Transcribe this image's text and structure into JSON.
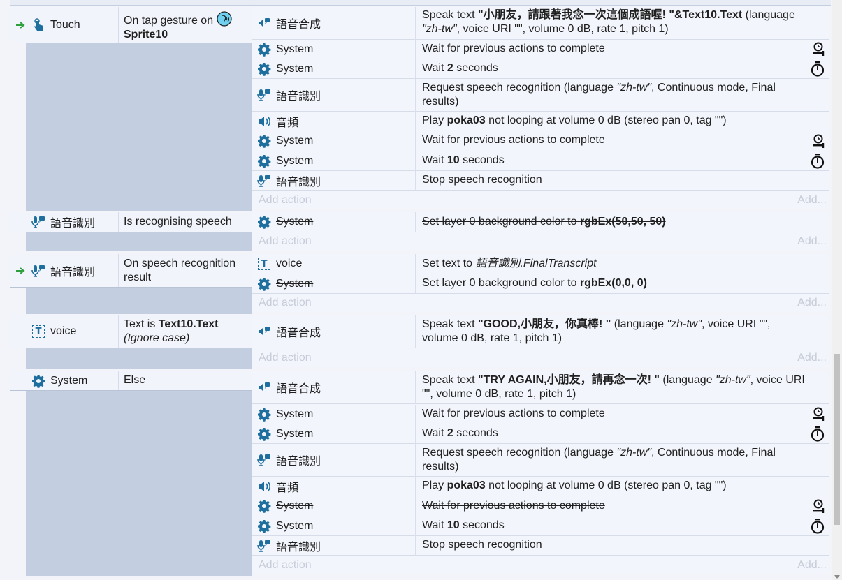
{
  "colors": {
    "accent_blue": "#1f6f9e",
    "trigger_green": "#2e9e3c",
    "event_bg": "#c3cee0",
    "row_bg": "#f2f5fb"
  },
  "add_action": "Add action",
  "add": "Add...",
  "events": [
    {
      "condition": {
        "object": "Touch",
        "text": "On tap gesture on",
        "target": "Sprite10",
        "icon": "touch-icon",
        "trigger": true
      },
      "actions": [
        {
          "object": "語音合成",
          "icon": "speech-synthesis-icon",
          "text_pre": "Speak text ",
          "text_b": "\"小朋友，請跟著我念一次這個成語喔! \"&Text10.Text",
          "text_mid": " (language ",
          "text_i": "\"zh-tw\"",
          "text_post": ", voice URI \"\", volume 0 dB, rate 1, pitch 1)"
        },
        {
          "object": "System",
          "icon": "gear-icon",
          "text": "Wait for previous actions to complete",
          "right_icon": "wait-signal-icon"
        },
        {
          "object": "System",
          "icon": "gear-icon",
          "text_pre": "Wait ",
          "text_b": "2",
          "text_post": " seconds",
          "right_icon": "stopwatch-icon"
        },
        {
          "object": "語音識別",
          "icon": "speech-recognition-icon",
          "text_pre": "Request speech recognition (language ",
          "text_i": "\"zh-tw\"",
          "text_post": ", Continuous mode, Final results)"
        },
        {
          "object": "音頻",
          "icon": "speaker-icon",
          "text_pre": "Play ",
          "text_b": "poka03",
          "text_post": " not looping at volume 0 dB (stereo pan 0, tag \"\")"
        },
        {
          "object": "System",
          "icon": "gear-icon",
          "text": "Wait for previous actions to complete",
          "right_icon": "wait-signal-icon"
        },
        {
          "object": "System",
          "icon": "gear-icon",
          "text_pre": "Wait ",
          "text_b": "10",
          "text_post": " seconds",
          "right_icon": "stopwatch-icon"
        },
        {
          "object": "語音識別",
          "icon": "speech-recognition-icon",
          "text": "Stop speech recognition"
        }
      ]
    },
    {
      "condition": {
        "object": "語音識別",
        "text": "Is recognising speech",
        "icon": "speech-recognition-icon",
        "trigger": false
      },
      "actions": [
        {
          "object": "System",
          "icon": "gear-icon",
          "text_pre": "Set layer 0 background color to ",
          "text_b": "rgbEx(50,50, 50)",
          "disabled": true
        }
      ]
    },
    {
      "condition": {
        "object": "語音識別",
        "text": "On speech recognition result",
        "icon": "speech-recognition-icon",
        "trigger": true
      },
      "actions": [
        {
          "object": "voice",
          "icon": "text-object-icon",
          "text_pre": "Set text to ",
          "text_i": "語音識別.FinalTranscript"
        },
        {
          "object": "System",
          "icon": "gear-icon",
          "text_pre": "Set layer 0 background color to ",
          "text_b": "rgbEx(0,0, 0)",
          "disabled": true
        }
      ]
    },
    {
      "condition": {
        "object": "voice",
        "text": "Text is",
        "target": "Text10.Text",
        "sub": "(Ignore case)",
        "icon": "text-object-icon",
        "trigger": false
      },
      "actions": [
        {
          "object": "語音合成",
          "icon": "speech-synthesis-icon",
          "text_pre": "Speak text ",
          "text_b": "\"GOOD,小朋友，你真棒! \"",
          "text_mid": " (language ",
          "text_i": "\"zh-tw\"",
          "text_post": ", voice URI \"\", volume 0 dB, rate 1, pitch 1)"
        }
      ]
    },
    {
      "condition": {
        "object": "System",
        "text": "Else",
        "icon": "gear-icon",
        "trigger": false
      },
      "actions": [
        {
          "object": "語音合成",
          "icon": "speech-synthesis-icon",
          "text_pre": "Speak text ",
          "text_b": "\"TRY AGAIN,小朋友，請再念一次! \"",
          "text_mid": " (language ",
          "text_i": "\"zh-tw\"",
          "text_post": ", voice URI \"\", volume 0 dB, rate 1, pitch 1)"
        },
        {
          "object": "System",
          "icon": "gear-icon",
          "text": "Wait for previous actions to complete",
          "right_icon": "wait-signal-icon"
        },
        {
          "object": "System",
          "icon": "gear-icon",
          "text_pre": "Wait ",
          "text_b": "2",
          "text_post": " seconds",
          "right_icon": "stopwatch-icon"
        },
        {
          "object": "語音識別",
          "icon": "speech-recognition-icon",
          "text_pre": "Request speech recognition (language ",
          "text_i": "\"zh-tw\"",
          "text_post": ", Continuous mode, Final results)"
        },
        {
          "object": "音頻",
          "icon": "speaker-icon",
          "text_pre": "Play ",
          "text_b": "poka03",
          "text_post": " not looping at volume 0 dB (stereo pan 0, tag \"\")"
        },
        {
          "object": "System",
          "icon": "gear-icon",
          "text": "Wait for previous actions to complete",
          "right_icon": "wait-signal-icon",
          "disabled": true
        },
        {
          "object": "System",
          "icon": "gear-icon",
          "text_pre": "Wait ",
          "text_b": "10",
          "text_post": " seconds",
          "right_icon": "stopwatch-icon"
        },
        {
          "object": "語音識別",
          "icon": "speech-recognition-icon",
          "text": "Stop speech recognition"
        }
      ]
    }
  ]
}
